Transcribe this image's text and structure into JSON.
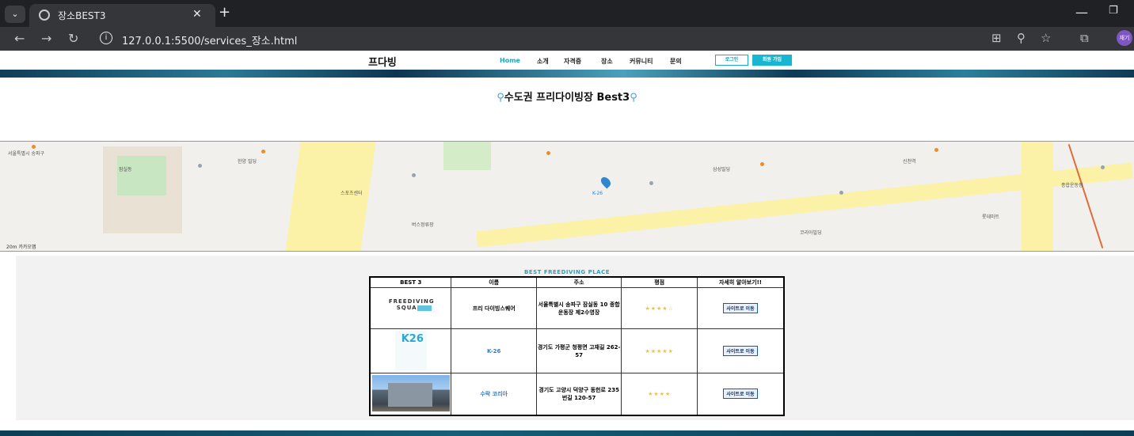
{
  "browser": {
    "tab_title": "장소BEST3",
    "url": "127.0.0.1:5500/services_장소.html",
    "profile_label": "재기"
  },
  "site": {
    "logo": "프다빙",
    "nav": [
      "Home",
      "소개",
      "자격증",
      "장소",
      "커뮤니티",
      "문의"
    ],
    "login_label": "로그인",
    "signup_label": "회원 가입",
    "page_title": "수도권 프리다이빙장 Best3"
  },
  "map": {
    "marker_label": "K-26",
    "scale_text": "20m 카카오맵",
    "labels": [
      "서울특별시 송파구",
      "잠실동",
      "한양 빌딩",
      "스포츠센터",
      "버스정류장",
      "삼성빌딩",
      "코리아빌딩",
      "신천역",
      "롯데마트",
      "종합운동장"
    ]
  },
  "table": {
    "section_title": "BEST FREEDIVING PLACE",
    "headers": [
      "BEST 3",
      "이름",
      "주소",
      "평점",
      "자세히 알아보기!!"
    ],
    "rows": [
      {
        "logo": "FREEDIVING SQUARE",
        "name": "프리 다이빙스퀘어",
        "address": "서울특별시 송파구 잠실동 10 종합운동장 제2수영장",
        "rating": "★★★★☆",
        "button": "사이트로 이동"
      },
      {
        "logo": "K26",
        "name": "K-26",
        "address": "경기도 가평군 청평면 고재길 262-57",
        "rating": "★★★★★",
        "button": "사이트로 이동"
      },
      {
        "logo": "photo",
        "name": "수락 코리아",
        "address": "경기도 고양시 덕양구 동헌로 235번길 120-57",
        "rating": "★★★★",
        "button": "사이트로 이동"
      }
    ]
  }
}
